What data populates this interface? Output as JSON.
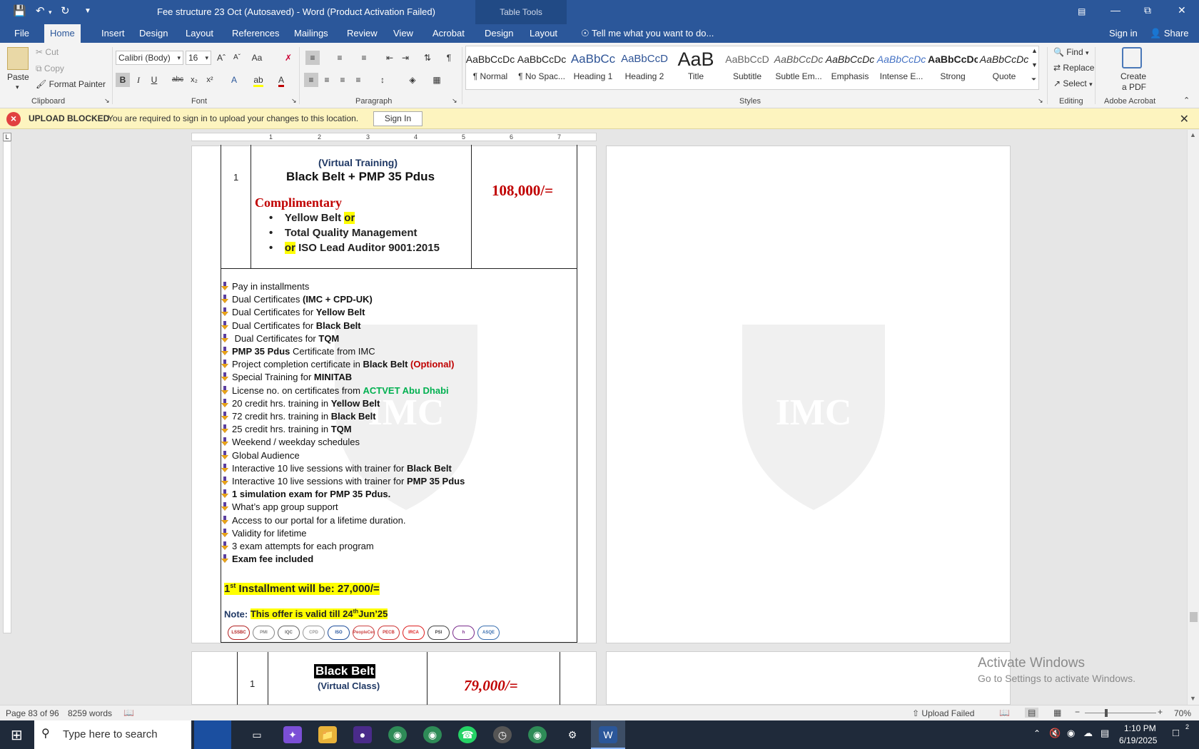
{
  "window": {
    "title": "Fee structure 23 Oct (Autosaved) - Word (Product Activation Failed)",
    "context_tab_group": "Table Tools"
  },
  "tabs": [
    "File",
    "Home",
    "Insert",
    "Design",
    "Layout",
    "References",
    "Mailings",
    "Review",
    "View",
    "Acrobat",
    "Design",
    "Layout"
  ],
  "active_tab": "Home",
  "tell_me": "Tell me what you want to do...",
  "sign_in": "Sign in",
  "share": "Share",
  "ribbon": {
    "clipboard": {
      "paste": "Paste",
      "cut": "Cut",
      "copy": "Copy",
      "format_painter": "Format Painter",
      "label": "Clipboard"
    },
    "font": {
      "name": "Calibri (Body)",
      "size": "16",
      "label": "Font",
      "change_case": "Aa"
    },
    "paragraph": {
      "label": "Paragraph"
    },
    "styles": {
      "label": "Styles",
      "items": [
        {
          "preview": "AaBbCcDc",
          "name": "¶ Normal"
        },
        {
          "preview": "AaBbCcDc",
          "name": "¶ No Spac..."
        },
        {
          "preview": "AaBbCc",
          "name": "Heading 1"
        },
        {
          "preview": "AaBbCcD",
          "name": "Heading 2"
        },
        {
          "preview": "AaB",
          "name": "Title"
        },
        {
          "preview": "AaBbCcD",
          "name": "Subtitle"
        },
        {
          "preview": "AaBbCcDc",
          "name": "Subtle Em..."
        },
        {
          "preview": "AaBbCcDc",
          "name": "Emphasis"
        },
        {
          "preview": "AaBbCcDc",
          "name": "Intense E..."
        },
        {
          "preview": "AaBbCcDc",
          "name": "Strong"
        },
        {
          "preview": "AaBbCcDc",
          "name": "Quote"
        }
      ]
    },
    "editing": {
      "find": "Find",
      "replace": "Replace",
      "select": "Select",
      "label": "Editing"
    },
    "acrobat": {
      "create_pdf_1": "Create",
      "create_pdf_2": "a PDF",
      "label": "Adobe Acrobat"
    }
  },
  "message_bar": {
    "title": "UPLOAD BLOCKED",
    "text": "You are required to sign in to upload your changes to this location.",
    "button": "Sign In"
  },
  "ruler_numbers": [
    "1",
    "2",
    "3",
    "4",
    "5",
    "6",
    "7"
  ],
  "document": {
    "row1": {
      "number": "1",
      "subtitle": "(Virtual Training)",
      "title": "Black Belt + PMP 35 Pdus",
      "price": "108,000/=",
      "complimentary": "Complimentary",
      "bullets": [
        "Yellow Belt ",
        "or",
        "Total Quality Management",
        "or",
        " ISO Lead Auditor 9001:2015"
      ]
    },
    "features": [
      {
        "pre": "Pay in installments",
        "bold": "",
        "post": "",
        "color": ""
      },
      {
        "pre": "Dual Certificates ",
        "bold": "(IMC + CPD-UK)",
        "post": "",
        "color": ""
      },
      {
        "pre": "Dual Certificates for ",
        "bold": "Yellow Belt",
        "post": "",
        "color": ""
      },
      {
        "pre": "Dual Certificates for ",
        "bold": "Black Belt",
        "post": "",
        "color": ""
      },
      {
        "pre": " Dual Certificates for ",
        "bold": "TQM",
        "post": "",
        "color": ""
      },
      {
        "pre": "",
        "bold": "PMP 35 Pdus",
        "post": " Certificate from IMC",
        "color": ""
      },
      {
        "pre": "Project completion certificate in ",
        "bold": "Black Belt",
        "post": "",
        "color": "",
        "red": " (Optional)"
      },
      {
        "pre": "Special Training for ",
        "bold": "MINITAB",
        "post": "",
        "color": ""
      },
      {
        "pre": "License no. on certificates from ",
        "bold": "",
        "post": "",
        "color": "",
        "green": "ACTVET Abu Dhabi"
      },
      {
        "pre": "20 credit hrs. training in ",
        "bold": "Yellow Belt",
        "post": "",
        "color": ""
      },
      {
        "pre": "72 credit hrs. training in ",
        "bold": "Black Belt",
        "post": "",
        "color": ""
      },
      {
        "pre": "25 credit hrs. training in ",
        "bold": "TQM",
        "post": "",
        "color": ""
      },
      {
        "pre": "Weekend / weekday schedules",
        "bold": "",
        "post": "",
        "color": ""
      },
      {
        "pre": "Global Audience",
        "bold": "",
        "post": "",
        "color": ""
      },
      {
        "pre": "Interactive 10 live sessions with trainer for ",
        "bold": "Black Belt",
        "post": "",
        "color": ""
      },
      {
        "pre": "Interactive 10 live sessions with trainer for ",
        "bold": "PMP 35 Pdus",
        "post": "",
        "color": ""
      },
      {
        "pre": "",
        "bold": "1 simulation exam for PMP 35 Pdus.",
        "post": "",
        "color": ""
      },
      {
        "pre": "What’s app group support",
        "bold": "",
        "post": "",
        "color": ""
      },
      {
        "pre": "Access to our portal for a lifetime duration.",
        "bold": "",
        "post": "",
        "color": ""
      },
      {
        "pre": "Validity for lifetime",
        "bold": "",
        "post": "",
        "color": ""
      },
      {
        "pre": "3 exam attempts for each program",
        "bold": "",
        "post": "",
        "color": ""
      },
      {
        "pre": "",
        "bold": "Exam fee included",
        "post": "",
        "color": ""
      }
    ],
    "installment": {
      "a": "1",
      "sup": "st",
      "b": " Installment will be: 27,000/="
    },
    "note": {
      "label": "Note: ",
      "a": "This offer is valid till 24",
      "sup": "th",
      "b": "Jun’25"
    },
    "logos": [
      "LSSBC",
      "PMI",
      "IQC",
      "CPD",
      "ISO",
      "PeopleCert",
      "PECB",
      "IRCA",
      "PSI",
      "h",
      "ASQE"
    ],
    "watermark": "IMC",
    "row2": {
      "number": "1",
      "title": "Black Belt",
      "subtitle": "(Virtual Class)",
      "price": "79,000/="
    }
  },
  "activate_windows": {
    "line1": "Activate Windows",
    "line2": "Go to Settings to activate Windows."
  },
  "status": {
    "page": "Page 83 of 96",
    "words": "8259 words",
    "upload": "Upload Failed",
    "zoom": "70%"
  },
  "taskbar": {
    "search": "Type here to search",
    "time": "1:10 PM",
    "date": "6/19/2025",
    "notifications": "2"
  },
  "colors": {
    "word_blue": "#2b579a",
    "price_red": "#c00000",
    "green": "#00b050",
    "highlight": "#ffff00",
    "navy": "#1f3864"
  }
}
